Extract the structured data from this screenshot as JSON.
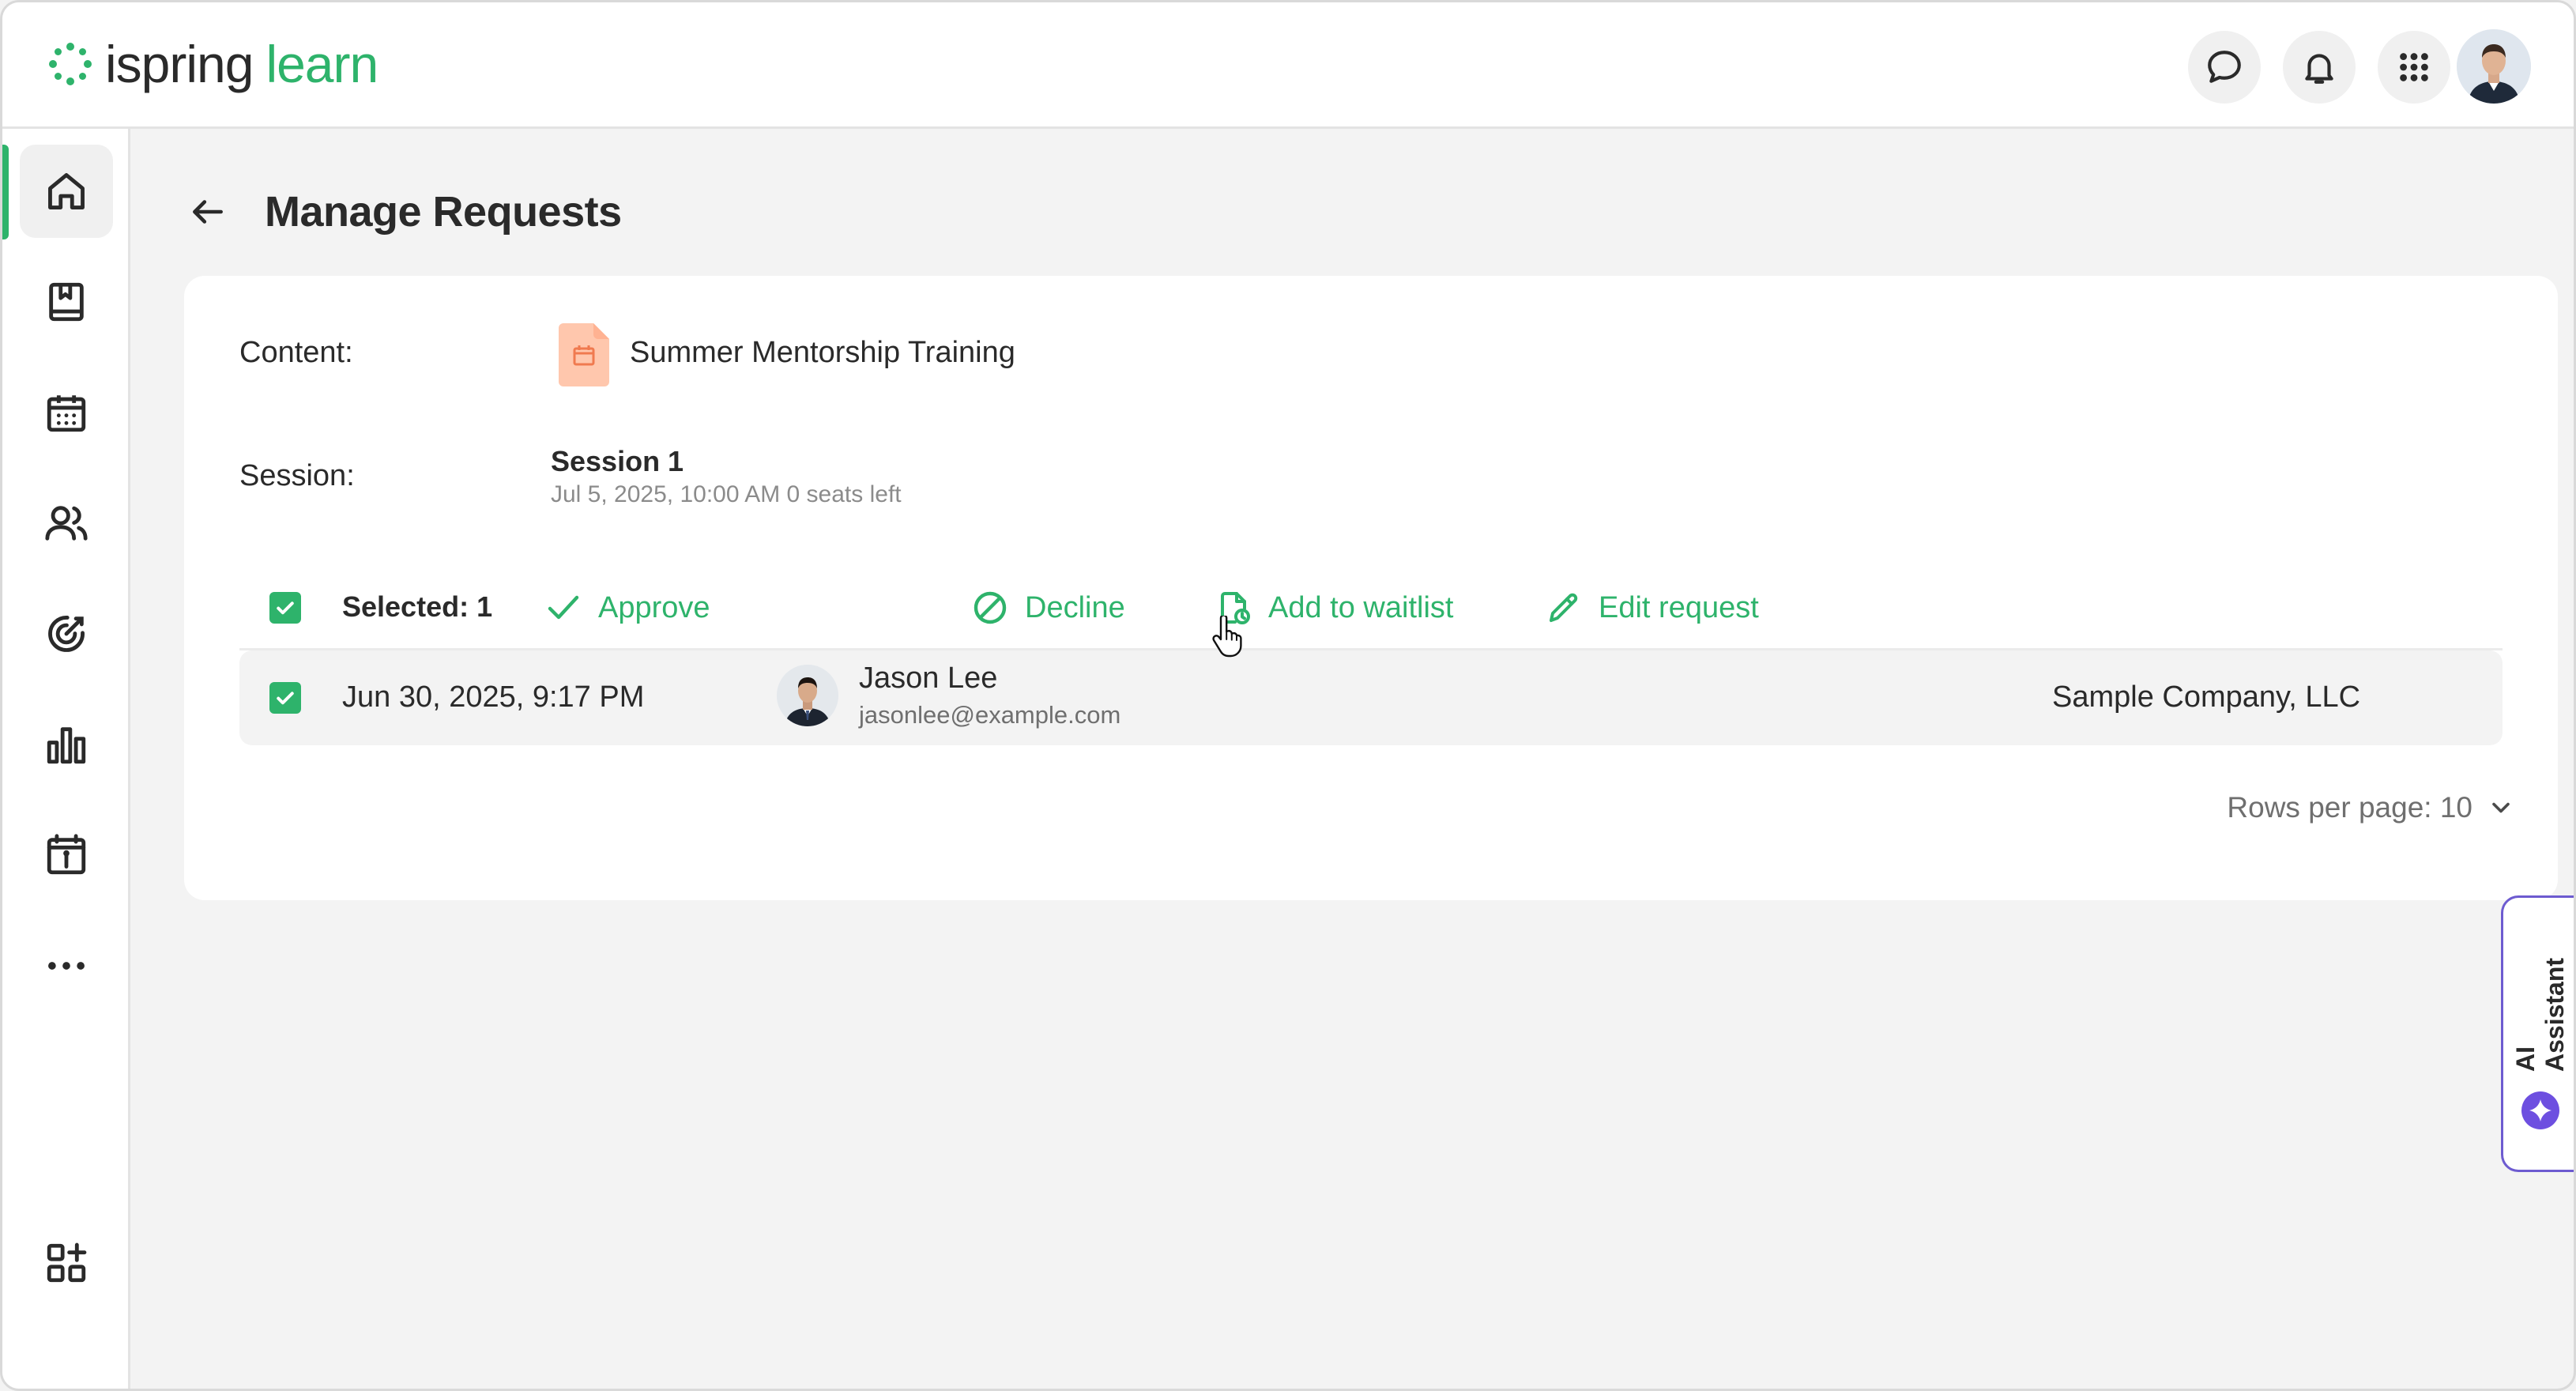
{
  "app": {
    "brand_primary": "ispring",
    "brand_secondary": "learn",
    "accent_color": "#2eb36b"
  },
  "header": {
    "icons": [
      "chat-icon",
      "bell-icon",
      "apps-grid-icon",
      "user-avatar"
    ]
  },
  "sidebar": {
    "items": [
      {
        "icon": "home-icon",
        "active": true
      },
      {
        "icon": "book-icon",
        "active": false
      },
      {
        "icon": "calendar-icon",
        "active": false
      },
      {
        "icon": "users-icon",
        "active": false
      },
      {
        "icon": "target-icon",
        "active": false
      },
      {
        "icon": "bar-chart-icon",
        "active": false
      },
      {
        "icon": "info-board-icon",
        "active": false
      },
      {
        "icon": "more-icon",
        "active": false
      },
      {
        "icon": "add-widget-icon",
        "active": false
      }
    ]
  },
  "page": {
    "title": "Manage Requests"
  },
  "details": {
    "content_label": "Content:",
    "content_title": "Summer Mentorship Training",
    "session_label": "Session:",
    "session_title": "Session 1",
    "session_meta": "Jul 5, 2025, 10:00 AM 0 seats left"
  },
  "toolbar": {
    "selected_label": "Selected: 1",
    "approve": "Approve",
    "decline": "Decline",
    "waitlist": "Add to waitlist",
    "edit": "Edit request"
  },
  "requests": [
    {
      "date": "Jun 30, 2025, 9:17 PM",
      "name": "Jason Lee",
      "email": "jasonlee@example.com",
      "company": "Sample Company, LLC",
      "checked": true
    }
  ],
  "pagination": {
    "rows_per_page": "Rows per page: 10"
  },
  "ai_assistant": {
    "label": "AI Assistant"
  }
}
